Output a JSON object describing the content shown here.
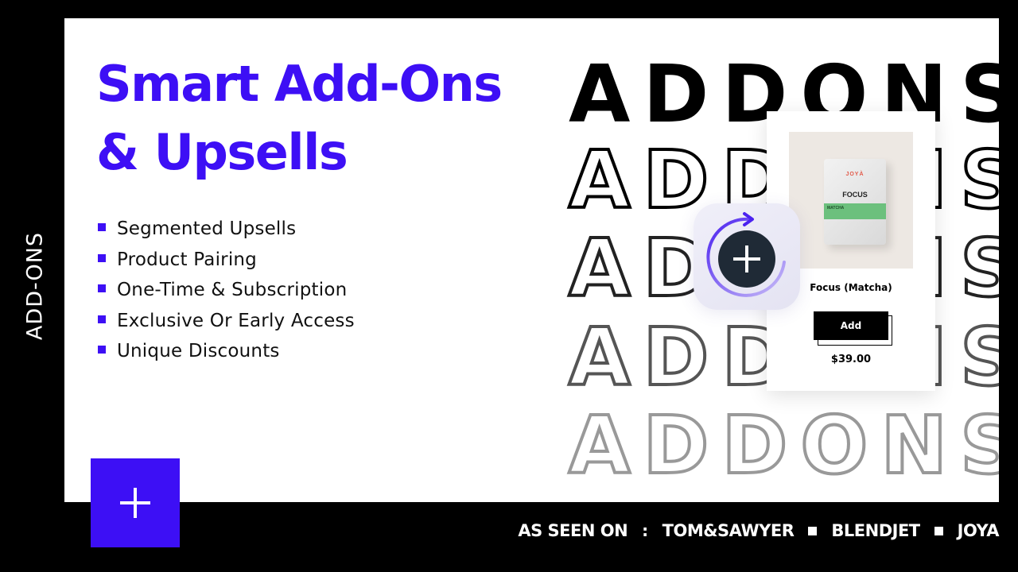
{
  "side_label": "ADD-ONS",
  "headline": {
    "line1": "Smart Add-Ons",
    "line2": "& Upsells"
  },
  "features": [
    "Segmented Upsells",
    "Product Pairing",
    "One-Time & Subscription",
    "Exclusive Or Early Access",
    "Unique Discounts"
  ],
  "background_word": "ADDONS",
  "product_card": {
    "brand": "JOYÀ",
    "pouch_title": "FOCUS",
    "pouch_flavor": "MATCHA",
    "name": "Focus (Matcha)",
    "button_label": "Add",
    "price": "$39.00"
  },
  "icons": {
    "addon_badge": "circular-arrow-plus-icon",
    "plus_square": "plus-icon"
  },
  "footer": {
    "prefix": "AS SEEN ON",
    "brands": [
      "TOM&SAWYER",
      "BLENDJET",
      "JOYA"
    ]
  },
  "colors": {
    "accent": "#3d0ff5",
    "background": "#000000",
    "panel": "#ffffff",
    "badge_circle": "#1f2a36"
  }
}
